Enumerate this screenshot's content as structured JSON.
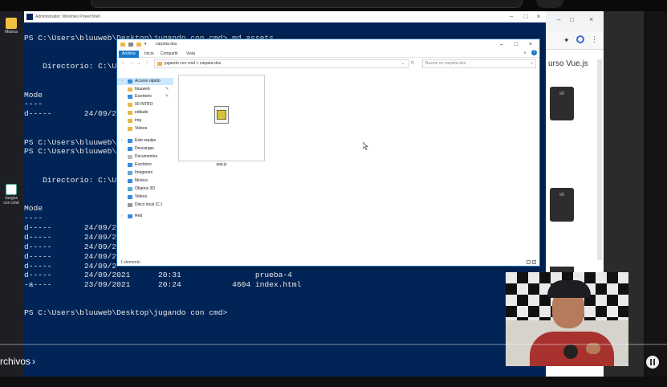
{
  "powershell": {
    "title": "Administrador: Windows PowerShell",
    "lines": [
      "PS C:\\Users\\bluuweb\\Desktop\\jugando con cmd> md assets",
      "    Directorio: C:\\Us",
      "Mode",
      "----",
      "d-----       24/09/2",
      "PS C:\\Users\\bluuweb\\Desktop\\",
      "PS C:\\Users\\bluuweb\\Desktop\\",
      "    Directorio: C:\\Us",
      "Mode",
      "----",
      "d-----       24/09/2",
      "d-----       24/09/2",
      "d-----       24/09/2",
      "d-----       24/09/2",
      "d-----       24/09/2",
      "d-----       24/09/2021      20:31                prueba-4",
      "-a----       23/09/2021      20:24           4604 index.html",
      "PS C:\\Users\\bluuweb\\Desktop\\jugando con cmd>"
    ]
  },
  "explorer": {
    "title": "carpeta-dos",
    "tabs": [
      "Archivo",
      "Inicio",
      "Compartir",
      "Vista"
    ],
    "breadcrumb": "jugando con cmd  >  carpeta-dos",
    "search_placeholder": "Buscar en carpeta-dos",
    "nav": [
      "Acceso rápido",
      "bluuweb",
      "Escritorio",
      "00 INTRO",
      "editado",
      "img",
      "Videos",
      "Este equipo",
      "Descargas",
      "Documentos",
      "Escritorio",
      "Imágenes",
      "Música",
      "Objetos 3D",
      "Videos",
      "Disco local (C:)",
      "Red"
    ],
    "file_name": "app.js",
    "status": "1 elemento"
  },
  "browser": {
    "title": "urso Vue.js",
    "box_label": "sh"
  },
  "desktop": {
    "icons": [
      "Música",
      "Juegos con cmd"
    ]
  },
  "player": {
    "chapter_label": "rchivos",
    "chevron": "›"
  },
  "colors": {
    "ps_bg": "#012456",
    "explorer_accent": "#1979ca"
  }
}
